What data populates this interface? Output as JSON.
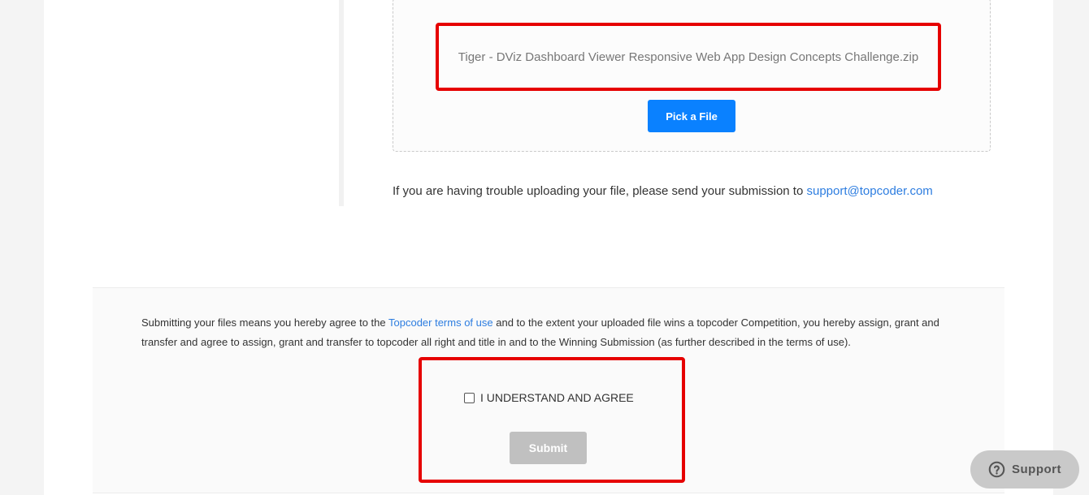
{
  "upload": {
    "filename": "Tiger - DViz Dashboard Viewer Responsive Web App Design Concepts Challenge.zip",
    "pick_button_label": "Pick a File",
    "trouble_text": "If you are having trouble uploading your file, please send your submission to ",
    "support_email": "support@topcoder.com"
  },
  "terms": {
    "text_before": "Submitting your files means you hereby agree to the ",
    "terms_link": "Topcoder terms of use",
    "text_after": " and to the extent your uploaded file wins a topcoder Competition, you hereby assign, grant and transfer and agree to assign, grant and transfer to topcoder all right and title in and to the Winning Submission (as further described in the terms of use).",
    "agree_label": "I UNDERSTAND AND AGREE",
    "agree_checked": false,
    "submit_label": "Submit",
    "submit_enabled": false
  },
  "support_widget": {
    "label": "Support",
    "icon": "help-circle-icon"
  },
  "colors": {
    "primary": "#0a81ff",
    "highlight": "#e60000",
    "link": "#2d7de0",
    "disabled": "#c0c0c0"
  }
}
